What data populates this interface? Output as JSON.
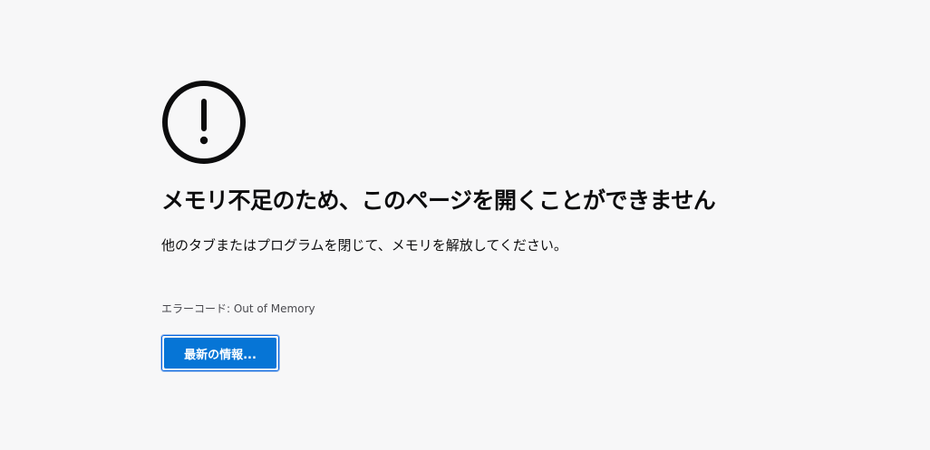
{
  "error_page": {
    "icon": "exclamation-circle-icon",
    "title": "メモリ不足のため、このページを開くことができません",
    "description": "他のタブまたはプログラムを閉じて、メモリを解放してください。",
    "error_code": "エラーコード: Out of Memory",
    "button_label": "最新の情報..."
  },
  "colors": {
    "background": "#f7f7f8",
    "text": "#0c0c0d",
    "secondary_text": "#4a4a4f",
    "button_bg": "#0675d6",
    "button_text": "#ffffff",
    "button_border": "#0060df"
  }
}
